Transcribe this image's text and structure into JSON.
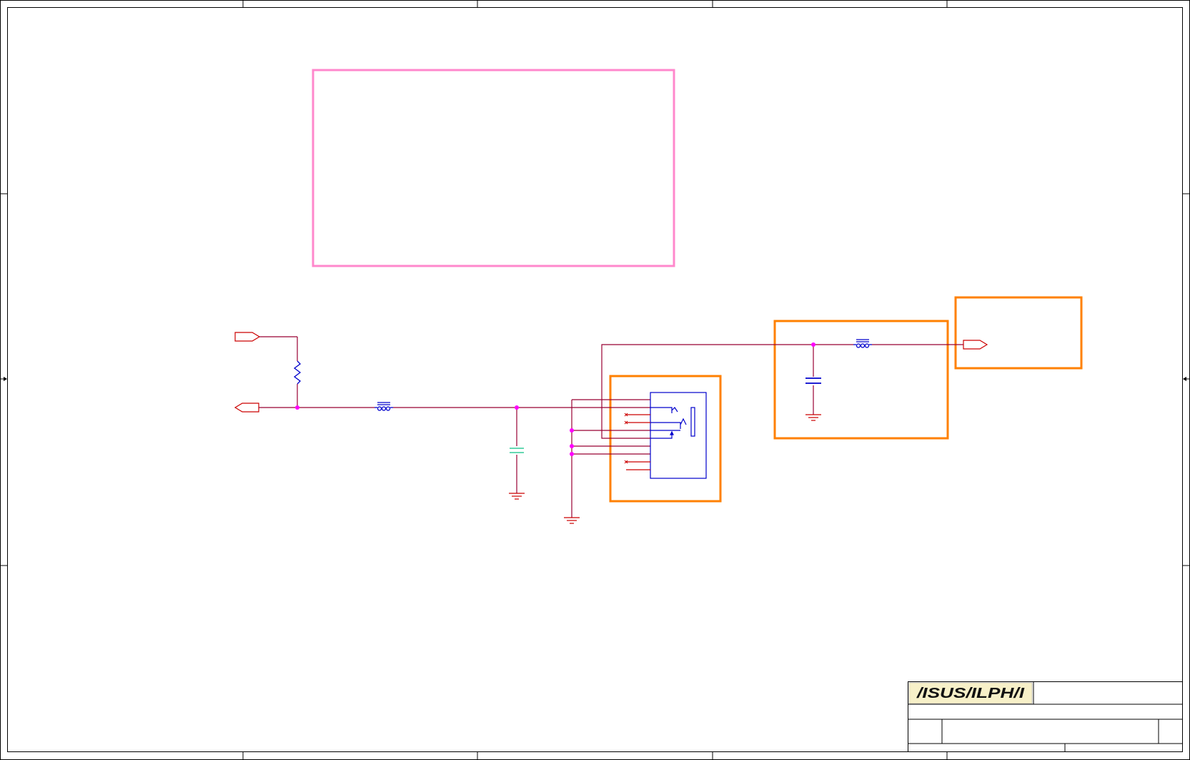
{
  "colors": {
    "wire": "#990033",
    "component": "#0000cc",
    "junction": "#ff00ff",
    "port": "#cc0000",
    "highlight_pink": "#ff88cc",
    "highlight_orange": "#ff8000",
    "capacitor_green": "#33cc99",
    "frame": "#000000",
    "logo_bg": "#f7f0c8"
  },
  "title_block": {
    "logo_text": "/ISUS/ILPH/I"
  }
}
